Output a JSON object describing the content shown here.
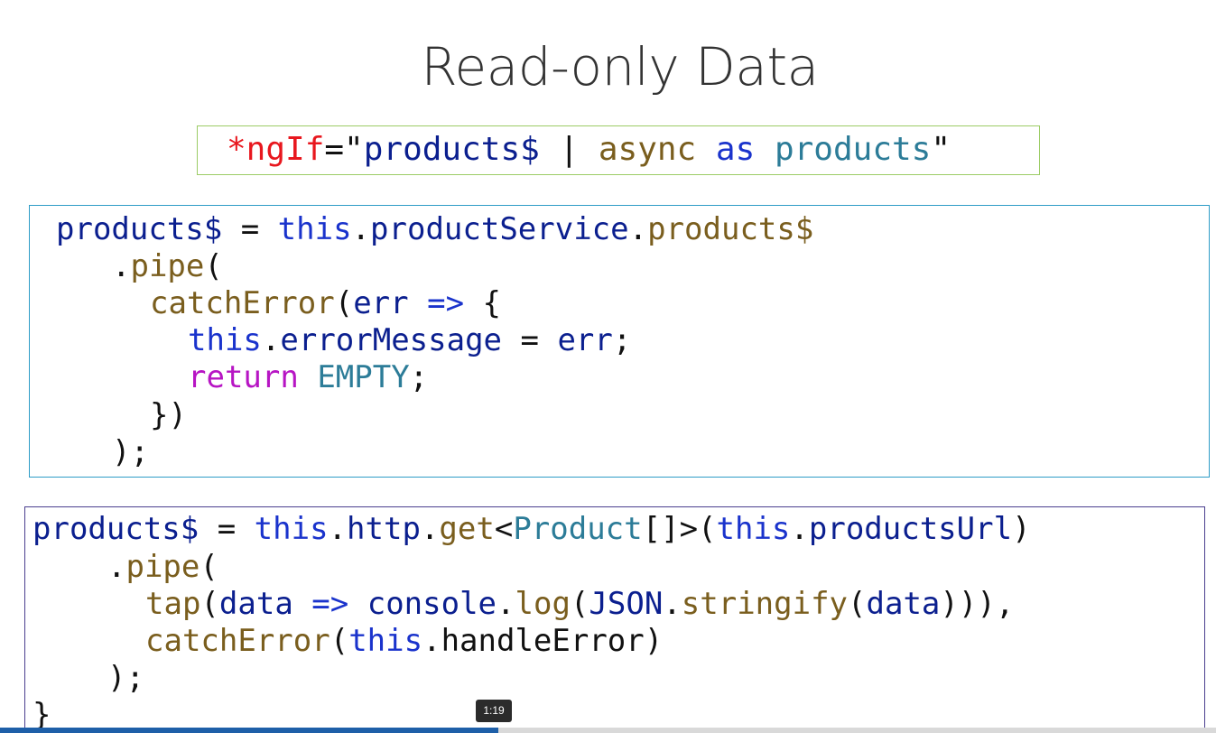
{
  "slide": {
    "title": "Read-only Data"
  },
  "template_snippet": {
    "ngIf": "*ngIf",
    "eq_quote": "=\"",
    "products_stream": "products$",
    "pipe_bar": " | ",
    "async": "async",
    "as": "as",
    "alias": "products",
    "close_quote": "\""
  },
  "service_code": {
    "line1": {
      "var": "products$",
      "eq": " = ",
      "this": "this",
      "dot1": ".",
      "service": "productService",
      "dot2": ".",
      "prop": "products$"
    },
    "line2": {
      "dot": ".",
      "pipe": "pipe",
      "paren": "("
    },
    "line3": {
      "fn": "catchError",
      "open": "(",
      "arg": "err",
      "arrow": "=>",
      "brace": "{"
    },
    "line4": {
      "this": "this",
      "dot": ".",
      "prop": "errorMessage",
      "eq": " = ",
      "val": "err",
      "semi": ";"
    },
    "line5": {
      "kw": "return",
      "val": "EMPTY",
      "semi": ";"
    },
    "line6": "})",
    "line7": ");"
  },
  "http_code": {
    "line1": {
      "var": "products$",
      "eq": " = ",
      "this1": "this",
      "dot1": ".",
      "http": "http",
      "dot2": ".",
      "get": "get",
      "lt": "<",
      "type": "Product",
      "arr": "[]",
      "gt_paren": ">(",
      "this2": "this",
      "dot3": ".",
      "url": "productsUrl",
      "close": ")"
    },
    "line2": {
      "dot": ".",
      "pipe": "pipe",
      "paren": "("
    },
    "line3": {
      "tap": "tap",
      "open": "(",
      "arg": "data",
      "arrow": "=>",
      "console": "console",
      "dot1": ".",
      "log": "log",
      "open2": "(",
      "json": "JSON",
      "dot2": ".",
      "stringify": "stringify",
      "open3": "(",
      "data": "data",
      "close": ")))",
      "comma": ","
    },
    "line4": {
      "fn": "catchError",
      "open": "(",
      "this": "this",
      "dot": ".",
      "handler": "handleError",
      "close": ")"
    },
    "line5": ");",
    "line6": "}"
  },
  "player": {
    "time_tooltip": "1:19",
    "progress_fraction": 0.41
  },
  "colors": {
    "template_border": "#9ccc65",
    "service_border": "#2e9cc7",
    "http_border": "#4b3f8f",
    "progress_fill": "#1e5fa8"
  }
}
